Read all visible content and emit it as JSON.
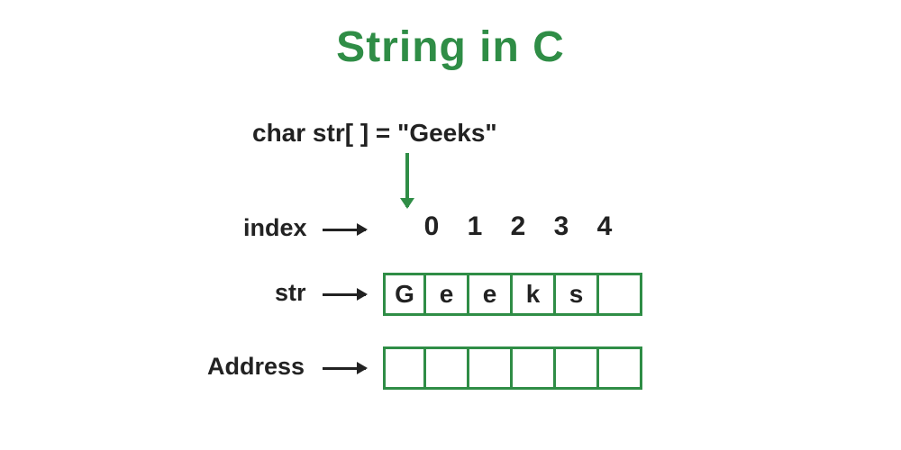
{
  "title": "String in C",
  "declaration": "char str[ ] = \"Geeks\"",
  "labels": {
    "index": "index",
    "str": "str",
    "address": "Address"
  },
  "indices": [
    "0",
    "1",
    "2",
    "3",
    "4"
  ],
  "str_cells": [
    "G",
    "e",
    "e",
    "k",
    "s",
    ""
  ],
  "address_cells": [
    "",
    "",
    "",
    "",
    "",
    ""
  ],
  "colors": {
    "accent": "#2f8d46",
    "text": "#222222"
  }
}
